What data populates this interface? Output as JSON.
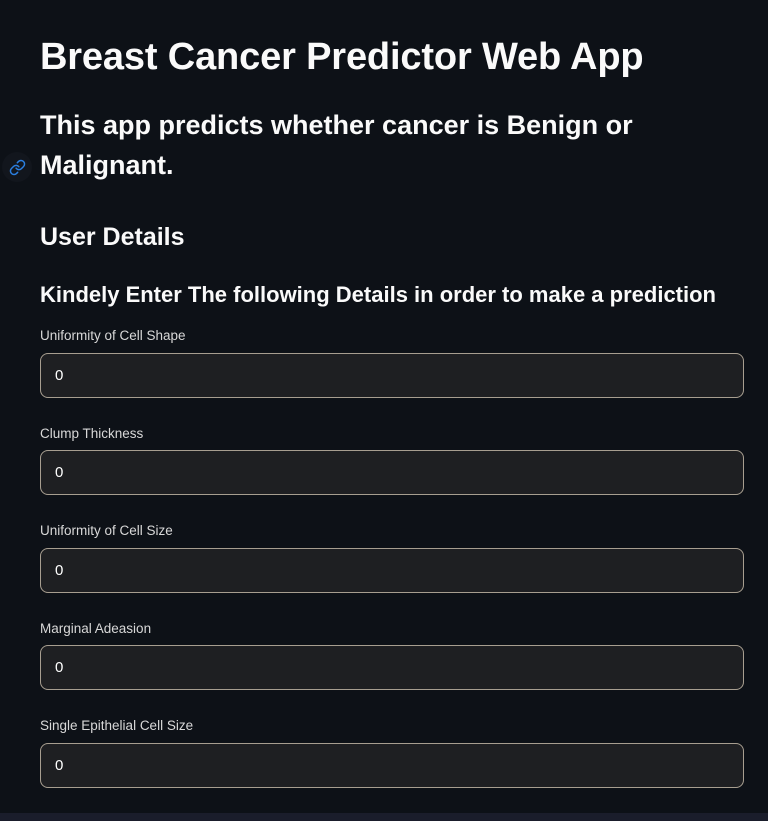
{
  "app": {
    "title": "Breast Cancer Predictor Web App",
    "subtitle": "This app predicts whether cancer is Benign or Malignant.",
    "section_title": "User Details",
    "section_subtitle": "Kindely Enter The following Details in order to make a prediction",
    "anchor_icon": "link-icon",
    "background_color": "#0d1117",
    "text_color": "#fafafa",
    "input_border_color": "#a79e90",
    "input_fill_color": "#1e1f22",
    "stepper_fill_color": "#202124",
    "label_color": "#d8d8d8",
    "anchor_icon_color": "#2b7fe0"
  },
  "fields": [
    {
      "label": "Uniformity of Cell Shape",
      "value": "0",
      "placeholder": "0",
      "decrement_label": "−",
      "increment_label": "+"
    },
    {
      "label": "Clump Thickness",
      "value": "0",
      "placeholder": "0",
      "decrement_label": "−",
      "increment_label": "+"
    },
    {
      "label": "Uniformity of Cell Size",
      "value": "0",
      "placeholder": "0",
      "decrement_label": "−",
      "increment_label": "+"
    },
    {
      "label": "Marginal Adeasion",
      "value": "0",
      "placeholder": "0",
      "decrement_label": "−",
      "increment_label": "+"
    },
    {
      "label": "Single Epithelial Cell Size",
      "value": "0",
      "placeholder": "0",
      "decrement_label": "−",
      "increment_label": "+"
    }
  ]
}
